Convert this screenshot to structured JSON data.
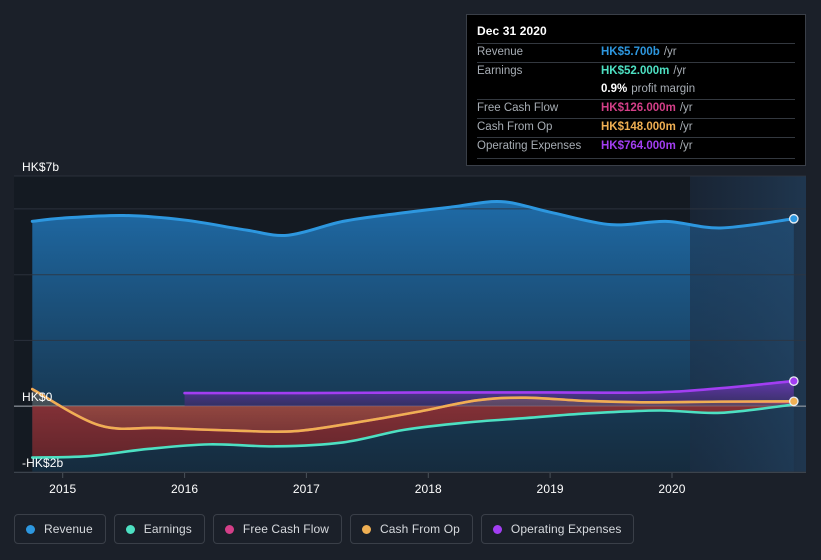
{
  "chart_data": {
    "type": "area",
    "title": "",
    "xlabel": "",
    "ylabel": "",
    "currency": "HK$",
    "grid": true,
    "legend_position": "bottom",
    "x_ticks": [
      "2015",
      "2016",
      "2017",
      "2018",
      "2019",
      "2020"
    ],
    "y_ticks": [
      {
        "label": "HK$7b",
        "value": 7
      },
      {
        "label": "HK$0",
        "value": 0
      },
      {
        "label": "-HK$2b",
        "value": -2
      }
    ],
    "ylim": [
      -2,
      7
    ],
    "xlim": [
      "2014.6",
      "2021.1"
    ],
    "gridline_values": [
      7,
      6,
      4,
      2,
      0,
      -2
    ],
    "zero_line_value": 0,
    "colors": {
      "revenue": "#2d97df",
      "earnings": "#4de0c2",
      "free_cash_flow": "#d43f88",
      "cash_from_op": "#efaf53",
      "operating_expenses": "#a23ef2",
      "background": "#1b2029",
      "plot_background": "#141a22",
      "gridline": "#2e3540",
      "zero_line": "#9aa0a8",
      "negative_fill": "#7c2b2e"
    },
    "series": [
      {
        "name": "Revenue",
        "key": "revenue",
        "unit": "b",
        "points": [
          {
            "x": 2014.75,
            "y": 5.62
          },
          {
            "x": 2015.0,
            "y": 5.72
          },
          {
            "x": 2015.5,
            "y": 5.8
          },
          {
            "x": 2016.0,
            "y": 5.66
          },
          {
            "x": 2016.5,
            "y": 5.36
          },
          {
            "x": 2016.85,
            "y": 5.2
          },
          {
            "x": 2017.3,
            "y": 5.62
          },
          {
            "x": 2017.75,
            "y": 5.86
          },
          {
            "x": 2018.2,
            "y": 6.06
          },
          {
            "x": 2018.6,
            "y": 6.22
          },
          {
            "x": 2019.0,
            "y": 5.9
          },
          {
            "x": 2019.5,
            "y": 5.52
          },
          {
            "x": 2019.95,
            "y": 5.62
          },
          {
            "x": 2020.4,
            "y": 5.42
          },
          {
            "x": 2021.0,
            "y": 5.7
          }
        ]
      },
      {
        "name": "Earnings",
        "key": "earnings",
        "unit": "m",
        "points": [
          {
            "x": 2014.75,
            "y": -1.56
          },
          {
            "x": 2015.2,
            "y": -1.52
          },
          {
            "x": 2015.7,
            "y": -1.3
          },
          {
            "x": 2016.2,
            "y": -1.16
          },
          {
            "x": 2016.75,
            "y": -1.22
          },
          {
            "x": 2017.3,
            "y": -1.1
          },
          {
            "x": 2017.8,
            "y": -0.72
          },
          {
            "x": 2018.3,
            "y": -0.5
          },
          {
            "x": 2018.8,
            "y": -0.36
          },
          {
            "x": 2019.3,
            "y": -0.22
          },
          {
            "x": 2019.9,
            "y": -0.13
          },
          {
            "x": 2020.4,
            "y": -0.2
          },
          {
            "x": 2021.0,
            "y": 0.052
          }
        ]
      },
      {
        "name": "Free Cash Flow",
        "key": "free_cash_flow",
        "unit": "m",
        "points": [
          {
            "x": 2014.75,
            "y": 0.52
          },
          {
            "x": 2015.3,
            "y": -0.58
          },
          {
            "x": 2015.8,
            "y": -0.66
          },
          {
            "x": 2016.4,
            "y": -0.74
          },
          {
            "x": 2016.9,
            "y": -0.76
          },
          {
            "x": 2017.4,
            "y": -0.5
          },
          {
            "x": 2017.9,
            "y": -0.18
          },
          {
            "x": 2018.4,
            "y": 0.18
          },
          {
            "x": 2018.8,
            "y": 0.26
          },
          {
            "x": 2019.3,
            "y": 0.16
          },
          {
            "x": 2019.8,
            "y": 0.12
          },
          {
            "x": 2020.4,
            "y": 0.14
          },
          {
            "x": 2021.0,
            "y": 0.126
          }
        ]
      },
      {
        "name": "Cash From Op",
        "key": "cash_from_op",
        "unit": "m",
        "points": [
          {
            "x": 2014.75,
            "y": 0.52
          },
          {
            "x": 2015.3,
            "y": -0.58
          },
          {
            "x": 2015.8,
            "y": -0.66
          },
          {
            "x": 2016.4,
            "y": -0.74
          },
          {
            "x": 2016.9,
            "y": -0.76
          },
          {
            "x": 2017.4,
            "y": -0.5
          },
          {
            "x": 2017.9,
            "y": -0.18
          },
          {
            "x": 2018.4,
            "y": 0.18
          },
          {
            "x": 2018.8,
            "y": 0.26
          },
          {
            "x": 2019.3,
            "y": 0.16
          },
          {
            "x": 2019.8,
            "y": 0.12
          },
          {
            "x": 2020.4,
            "y": 0.14
          },
          {
            "x": 2021.0,
            "y": 0.148
          }
        ]
      },
      {
        "name": "Operating Expenses",
        "key": "operating_expenses",
        "unit": "m",
        "starts_at_x": 2016.0,
        "points": [
          {
            "x": 2016.0,
            "y": 0.4
          },
          {
            "x": 2017.0,
            "y": 0.4
          },
          {
            "x": 2018.0,
            "y": 0.42
          },
          {
            "x": 2019.0,
            "y": 0.42
          },
          {
            "x": 2020.0,
            "y": 0.44
          },
          {
            "x": 2021.0,
            "y": 0.764
          }
        ]
      }
    ]
  },
  "tooltip": {
    "title": "Dec 31 2020",
    "rows": [
      {
        "label": "Revenue",
        "value": "HK$5.700b",
        "unit": "/yr",
        "color": "#2d97df"
      },
      {
        "label": "Earnings",
        "value": "HK$52.000m",
        "unit": "/yr",
        "color": "#4de0c2"
      },
      {
        "label": "",
        "value": "0.9%",
        "unit": "profit margin",
        "color": "#ffffff",
        "no_rule": true
      },
      {
        "label": "Free Cash Flow",
        "value": "HK$126.000m",
        "unit": "/yr",
        "color": "#d43f88"
      },
      {
        "label": "Cash From Op",
        "value": "HK$148.000m",
        "unit": "/yr",
        "color": "#efaf53"
      },
      {
        "label": "Operating Expenses",
        "value": "HK$764.000m",
        "unit": "/yr",
        "color": "#a23ef2"
      }
    ]
  },
  "legend": {
    "items": [
      {
        "label": "Revenue",
        "color": "#2d97df"
      },
      {
        "label": "Earnings",
        "color": "#4de0c2"
      },
      {
        "label": "Free Cash Flow",
        "color": "#d43f88"
      },
      {
        "label": "Cash From Op",
        "color": "#efaf53"
      },
      {
        "label": "Operating Expenses",
        "color": "#a23ef2"
      }
    ]
  }
}
